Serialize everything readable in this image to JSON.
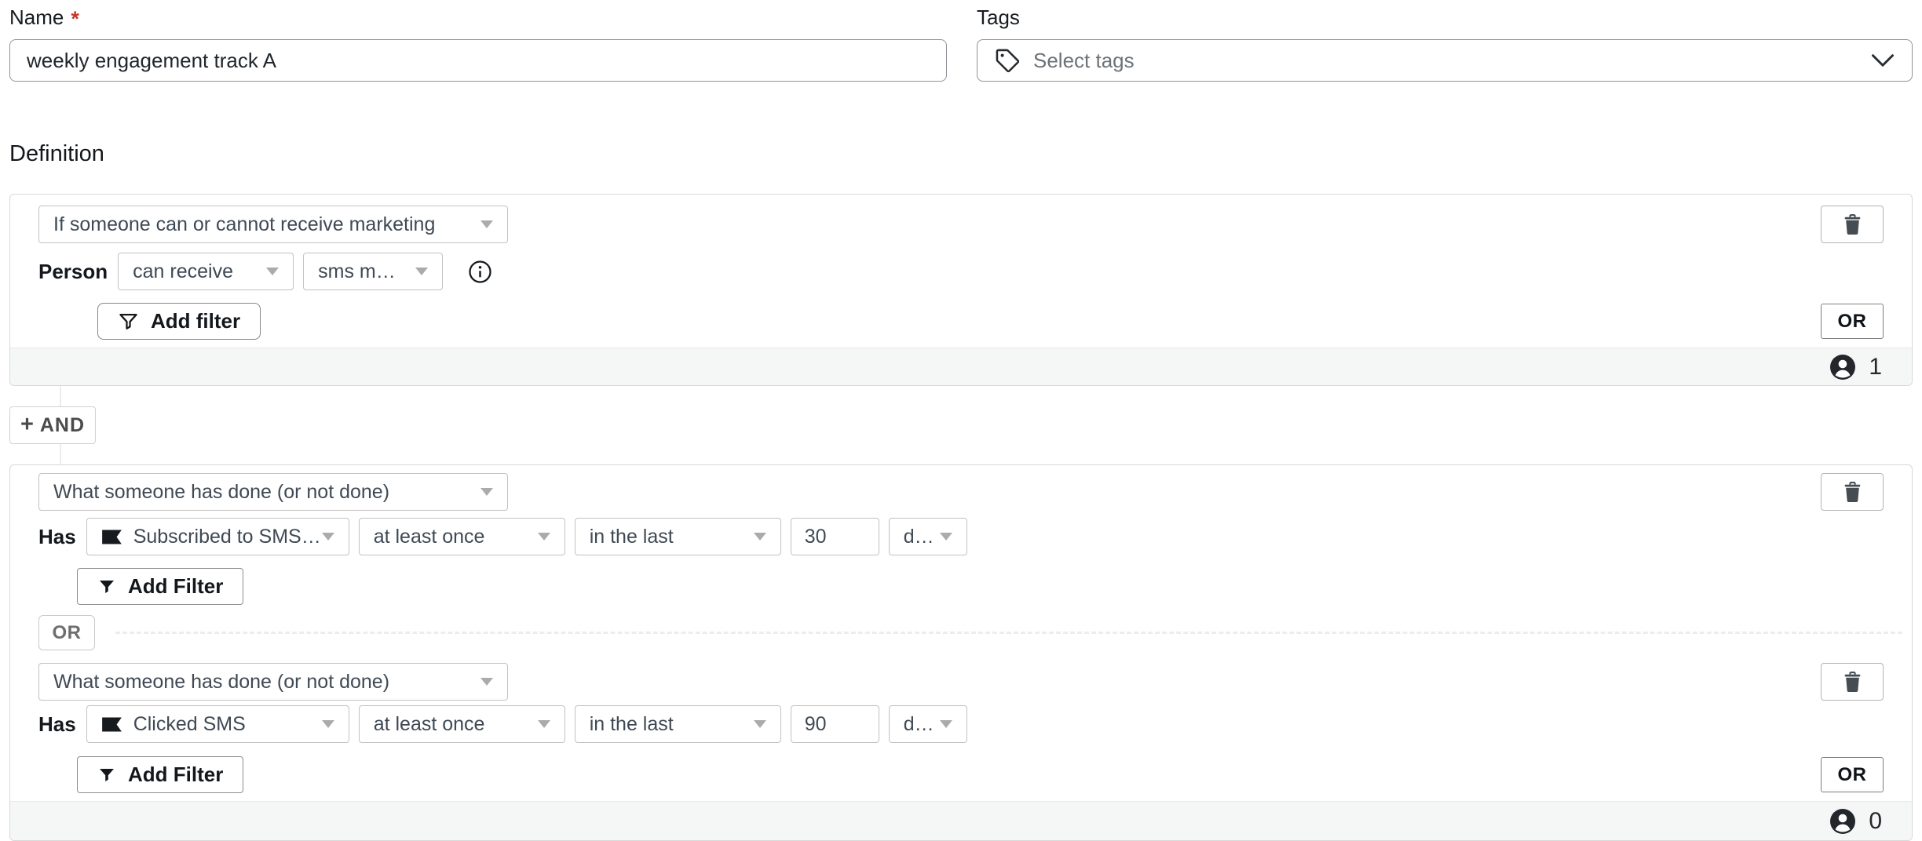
{
  "form": {
    "name_label": "Name",
    "required_marker": "*",
    "name_value": "weekly engagement track A",
    "tags_label": "Tags",
    "tags_placeholder": "Select tags"
  },
  "definition": {
    "heading": "Definition"
  },
  "group1": {
    "condition": "If someone can or cannot receive marketing",
    "row_label": "Person",
    "consent_op": "can receive",
    "channel": "sms marketing",
    "add_filter_label": "Add filter",
    "or_label": "OR",
    "member_count": "1"
  },
  "and_button": {
    "plus": "+",
    "label": "AND"
  },
  "group2": {
    "add_filter_label": "Add Filter",
    "or_left_label": "OR",
    "or_right_label": "OR",
    "member_count": "0",
    "conditions": [
      {
        "condition": "What someone has done (or not done)",
        "row_label": "Has",
        "metric": "Subscribed to SMS Mar...",
        "frequency": "at least once",
        "timeframe": "in the last",
        "value": "30",
        "unit": "days"
      },
      {
        "condition": "What someone has done (or not done)",
        "row_label": "Has",
        "metric": "Clicked SMS",
        "frequency": "at least once",
        "timeframe": "in the last",
        "value": "90",
        "unit": "days"
      }
    ]
  },
  "icons": {
    "tag": "tag-icon",
    "chevron": "chevron-down-icon",
    "trash": "trash-icon",
    "info": "info-icon",
    "funnel": "funnel-icon",
    "person": "person-count-icon",
    "metric": "metric-flag-icon"
  },
  "colors": {
    "required_red": "#c9362c",
    "footer_bg": "#f5f6f6",
    "block_border": "#d8d8d8",
    "icon_dark": "#1a1f24"
  }
}
